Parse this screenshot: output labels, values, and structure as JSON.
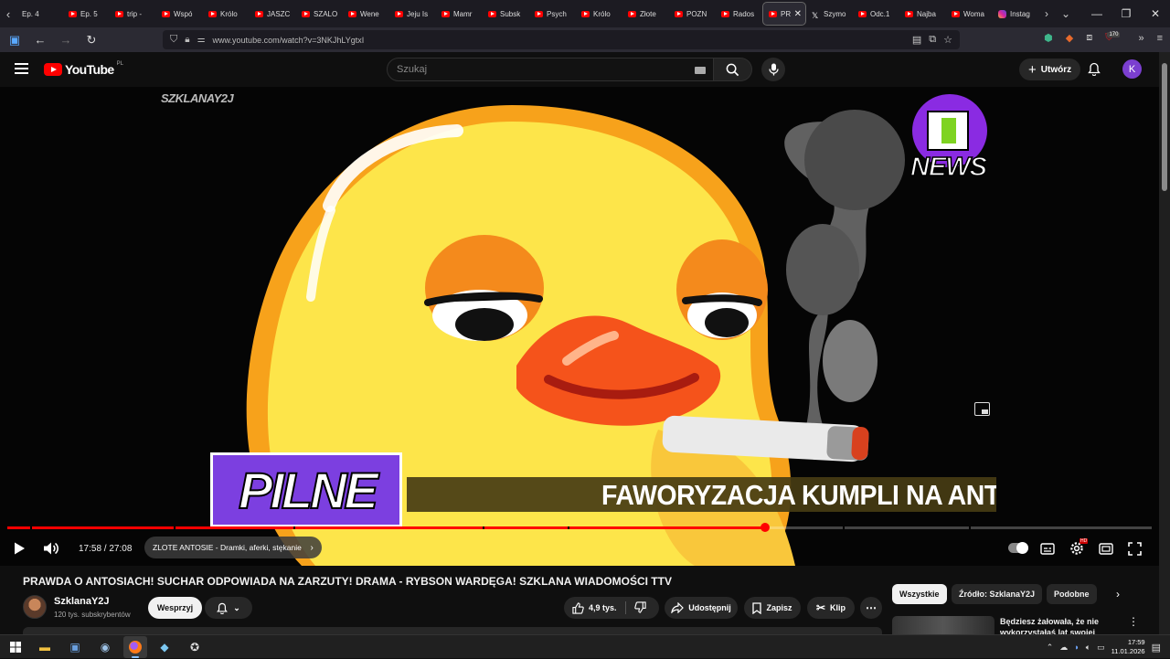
{
  "browser": {
    "tabs": [
      {
        "label": "Ep. 4",
        "icon": "none"
      },
      {
        "label": "Ep. 5",
        "icon": "youtube"
      },
      {
        "label": "trip - ",
        "icon": "youtube"
      },
      {
        "label": "Wspó",
        "icon": "youtube"
      },
      {
        "label": "Królo",
        "icon": "youtube"
      },
      {
        "label": "JASZC",
        "icon": "youtube"
      },
      {
        "label": "SZALO",
        "icon": "youtube"
      },
      {
        "label": "Wene",
        "icon": "youtube"
      },
      {
        "label": "Jeju Is",
        "icon": "youtube"
      },
      {
        "label": "Mamr",
        "icon": "youtube"
      },
      {
        "label": "Subsk",
        "icon": "youtube"
      },
      {
        "label": "Psych",
        "icon": "youtube"
      },
      {
        "label": "Królo",
        "icon": "youtube"
      },
      {
        "label": "Złote",
        "icon": "youtube"
      },
      {
        "label": "POZN",
        "icon": "youtube"
      },
      {
        "label": "Rados",
        "icon": "youtube"
      },
      {
        "label": "PR",
        "icon": "youtube",
        "active": true
      },
      {
        "label": "Szymo",
        "icon": "x"
      },
      {
        "label": "Odc.1",
        "icon": "youtube"
      },
      {
        "label": "Najba",
        "icon": "youtube"
      },
      {
        "label": "Woma",
        "icon": "youtube"
      },
      {
        "label": "Instag",
        "icon": "instagram"
      }
    ],
    "url": "www.youtube.com/watch?v=3NKJhLYgtxI",
    "extensions_badge": "170"
  },
  "youtube": {
    "logo_text": "YouTube",
    "logo_region": "PL",
    "search_placeholder": "Szukaj",
    "create_label": "Utwórz",
    "avatar_letter": "K",
    "avatar_color": "#7b3fd0"
  },
  "video": {
    "watermark": "SZKLANAY2J",
    "news_logo_text": "NEWS",
    "banner_label": "PILNE",
    "ticker_text": "FAWORYZACJA KUMPLI NA ANTOS",
    "time_current": "17:58",
    "time_total": "27:08",
    "time_display": "17:58 / 27:08",
    "progress_fraction": 0.662,
    "chapter_title": "ZLOTE ANTOSIE - Dramki, aferki, stękanie",
    "chapter_marks": [
      0.02,
      0.145,
      0.25,
      0.415,
      0.49,
      0.73,
      0.84
    ],
    "hd_badge": "HD"
  },
  "details": {
    "title": "PRAWDA O ANTOSIACH! SUCHAR ODPOWIADA NA ZARZUTY! DRAMA - RYBSON WARDĘGA! SZKLANA WIADOMOŚCI TTV",
    "channel_name": "SzklanaY2J",
    "subscribers": "120 tys. subskrybentów",
    "support_label": "Wesprzyj",
    "like_count": "4,9 tys.",
    "share_label": "Udostępnij",
    "save_label": "Zapisz",
    "clip_label": "Klip"
  },
  "sidebar": {
    "chips": [
      {
        "label": "Wszystkie",
        "active": true
      },
      {
        "label": "Źródło: SzklanaY2J",
        "active": false
      },
      {
        "label": "Podobne",
        "active": false
      }
    ],
    "rec_title": "Będziesz żałowała, że nie wykorzystałaś lat swojej"
  },
  "taskbar": {
    "time": "17:59",
    "date": "11.01.2026"
  }
}
